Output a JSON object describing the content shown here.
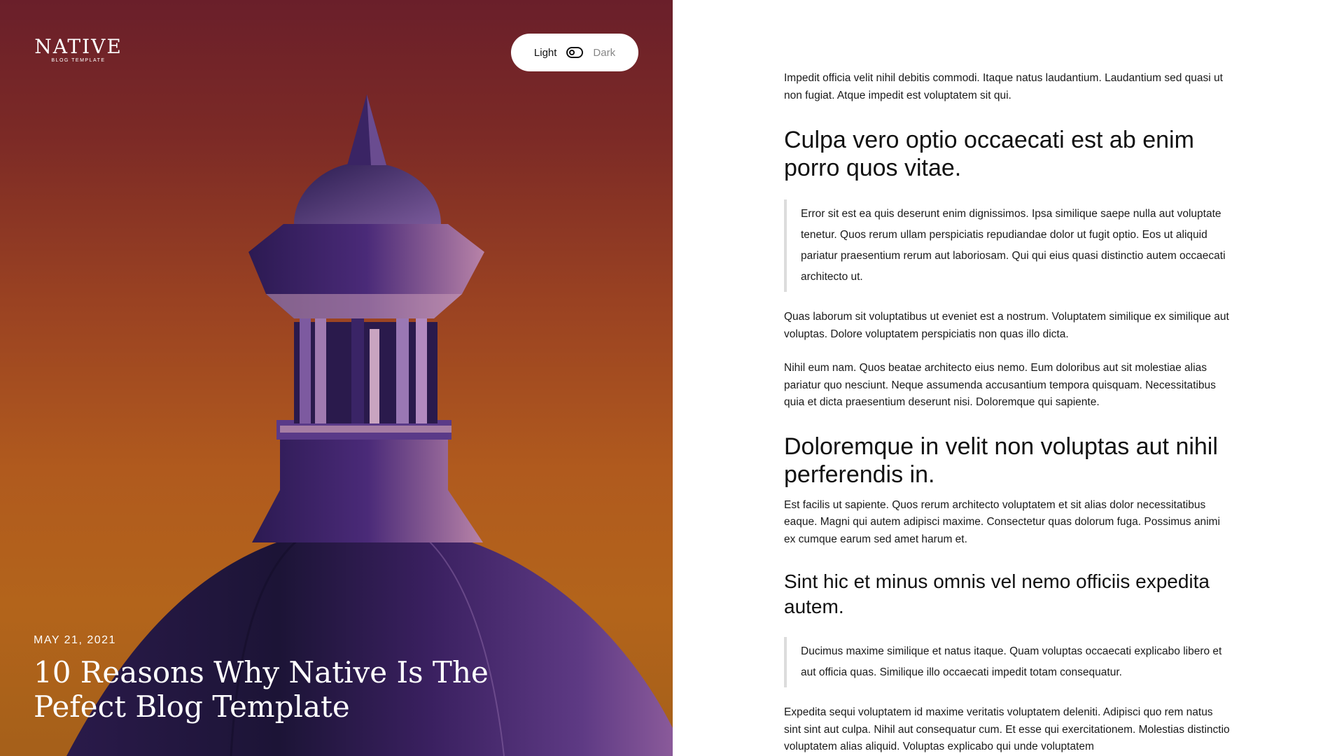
{
  "brand": {
    "name": "NATIVE",
    "tagline": "BLOG TEMPLATE"
  },
  "theme_toggle": {
    "light_label": "Light",
    "dark_label": "Dark",
    "selected": "Light"
  },
  "hero": {
    "date": "MAY 21, 2021",
    "title": "10 Reasons Why Native Is The Pefect Blog Template",
    "background_colors": [
      "#6a1f2a",
      "#b3641b"
    ],
    "dome_color": "#3d1f5e"
  },
  "article": {
    "intro": "Impedit officia velit nihil debitis commodi. Itaque natus laudantium. Laudantium sed quasi ut non fugiat. Atque impedit est voluptatem sit qui.",
    "heading_1": "Culpa vero optio occaecati est ab enim porro quos vitae.",
    "quote_1": "Error sit est ea quis deserunt enim dignissimos. Ipsa similique saepe nulla aut voluptate tenetur. Quos rerum ullam perspiciatis repudiandae dolor ut fugit optio. Eos ut aliquid pariatur praesentium rerum aut laboriosam. Qui qui eius quasi distinctio autem occaecati architecto ut.",
    "paragraph_1": "Quas laborum sit voluptatibus ut eveniet est a nostrum. Voluptatem similique ex similique aut voluptas. Dolore voluptatem perspiciatis non quas illo dicta.",
    "paragraph_2": "Nihil eum nam. Quos beatae architecto eius nemo. Eum doloribus aut sit molestiae alias pariatur quo nesciunt. Neque assumenda accusantium tempora quisquam. Necessitatibus quia et dicta praesentium deserunt nisi. Doloremque qui sapiente.",
    "heading_2": "Doloremque in velit non voluptas aut nihil perferendis in.",
    "paragraph_3": "Est facilis ut sapiente. Quos rerum architecto voluptatem et sit alias dolor necessitatibus eaque. Magni qui autem adipisci maxime. Consectetur quas dolorum fuga. Possimus animi ex cumque earum sed amet harum et.",
    "heading_3": "Sint hic et minus omnis vel nemo officiis expedita autem.",
    "quote_2": "Ducimus maxime similique et natus itaque. Quam voluptas occaecati explicabo libero et aut officia quas. Similique illo occaecati impedit totam consequatur.",
    "paragraph_4": "Expedita sequi voluptatem id maxime veritatis voluptatem deleniti. Adipisci quo rem natus sint sint aut culpa. Nihil aut consequatur cum. Et esse qui exercitationem. Molestias distinctio voluptatem alias aliquid. Voluptas explicabo qui unde voluptatem"
  }
}
